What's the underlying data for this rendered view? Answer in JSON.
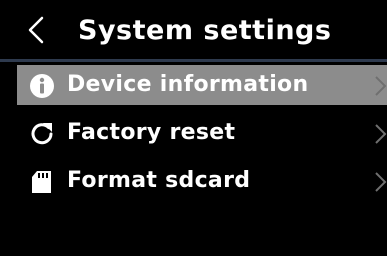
{
  "header": {
    "title": "System settings",
    "back_icon": "chevron-left-icon"
  },
  "menu": {
    "items": [
      {
        "label": "Device information",
        "icon": "info-icon",
        "selected": true
      },
      {
        "label": "Factory reset",
        "icon": "reset-icon",
        "selected": false
      },
      {
        "label": "Format sdcard",
        "icon": "sdcard-icon",
        "selected": false
      }
    ]
  },
  "colors": {
    "background": "#000000",
    "text": "#ffffff",
    "selected_row": "#8c8c8c",
    "divider": "#2e3a4e",
    "chevron": "#6f6f6f"
  }
}
